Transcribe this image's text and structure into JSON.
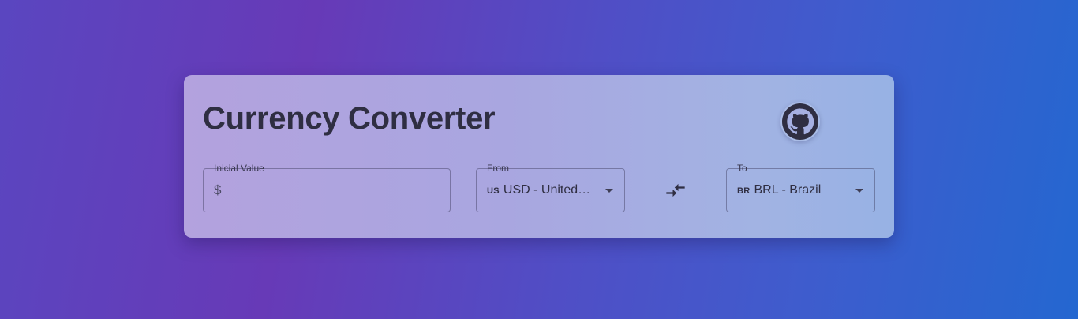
{
  "header": {
    "title": "Currency Converter",
    "github_icon": "github-icon"
  },
  "inputs": {
    "value": {
      "label": "Inicial Value",
      "prefix": "$",
      "value": ""
    },
    "from": {
      "label": "From",
      "flag_code": "US",
      "selected": "USD - United ..."
    },
    "to": {
      "label": "To",
      "flag_code": "BR",
      "selected": "BRL - Brazil"
    },
    "swap_icon": "swap-arrows-icon"
  },
  "colors": {
    "card_text": "#2f2e42",
    "bg_left": "#673ab7",
    "bg_right": "#2467d0"
  }
}
